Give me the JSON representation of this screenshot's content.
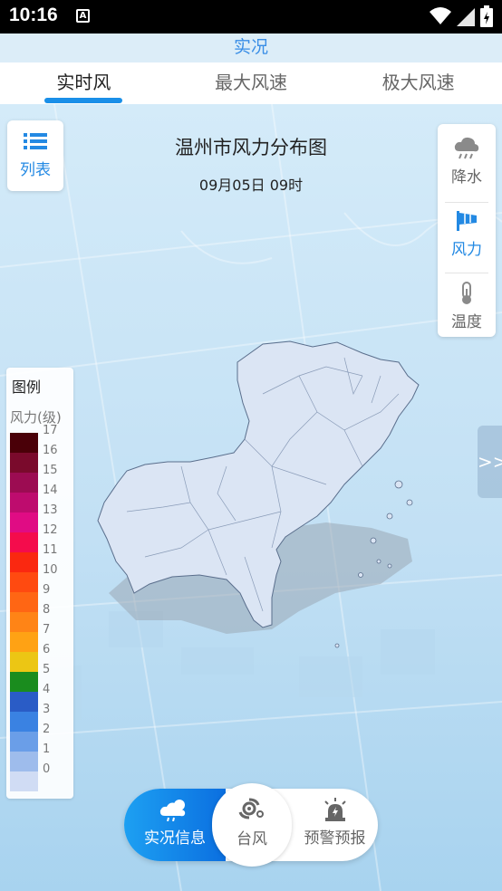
{
  "status_bar": {
    "time": "10:16",
    "notification_glyph": "A",
    "icons": [
      "wifi-icon",
      "signal-icon",
      "battery-icon"
    ]
  },
  "header": {
    "title": "实况"
  },
  "tabs": [
    {
      "label": "实时风",
      "active": true
    },
    {
      "label": "最大风速",
      "active": false
    },
    {
      "label": "极大风速",
      "active": false
    }
  ],
  "map": {
    "title": "温州市风力分布图",
    "time": "09月05日 09时"
  },
  "list_button": {
    "label": "列表",
    "icon": "list-icon"
  },
  "layers": [
    {
      "label": "降水",
      "icon": "rain-cloud-icon",
      "active": false
    },
    {
      "label": "风力",
      "icon": "wind-flag-icon",
      "active": true
    },
    {
      "label": "温度",
      "icon": "thermometer-icon",
      "active": false
    }
  ],
  "side_toggle": {
    "glyph": ">>"
  },
  "legend": {
    "title": "图例",
    "unit": "风力(级)",
    "levels": [
      {
        "label": "17",
        "color": "#4a0008"
      },
      {
        "label": "16",
        "color": "#7a0a2c"
      },
      {
        "label": "15",
        "color": "#9c0c52"
      },
      {
        "label": "14",
        "color": "#be0c6e"
      },
      {
        "label": "13",
        "color": "#e00c84"
      },
      {
        "label": "12",
        "color": "#f40c4c"
      },
      {
        "label": "11",
        "color": "#fa2810"
      },
      {
        "label": "10",
        "color": "#ff4a10"
      },
      {
        "label": "9",
        "color": "#ff6614"
      },
      {
        "label": "8",
        "color": "#ff8416"
      },
      {
        "label": "7",
        "color": "#ffa214"
      },
      {
        "label": "6",
        "color": "#ecc614"
      },
      {
        "label": "5",
        "color": "#1a8c1e"
      },
      {
        "label": "4",
        "color": "#2a5cc6"
      },
      {
        "label": "3",
        "color": "#3a82e2"
      },
      {
        "label": "2",
        "color": "#6a9ee8"
      },
      {
        "label": "1",
        "color": "#9ebcec"
      },
      {
        "label": "0",
        "color": "#d0dcf4"
      }
    ]
  },
  "bottom_nav": {
    "items": [
      {
        "label": "实况信息",
        "icon": "weather-icon",
        "active": true
      },
      {
        "label": "台风",
        "icon": "typhoon-icon",
        "active": false
      },
      {
        "label": "预警预报",
        "icon": "alarm-icon",
        "active": false
      }
    ]
  },
  "colors": {
    "accent": "#1a8fe8",
    "tab_underline": "#1a8fe8",
    "region_fill": "#dbe5f4"
  }
}
